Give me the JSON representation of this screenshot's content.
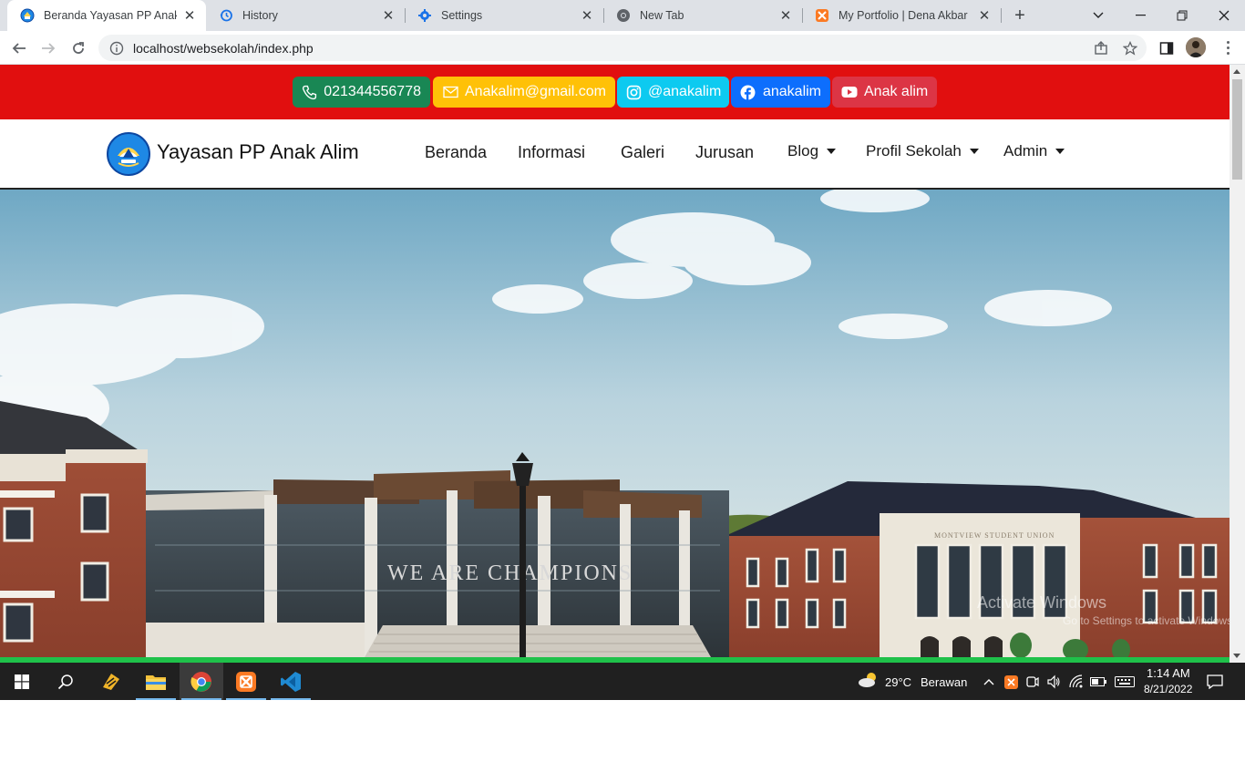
{
  "browser": {
    "tabs": [
      {
        "title": "Beranda Yayasan PP Anak Alim",
        "icon": "school-favicon-icon",
        "active": true
      },
      {
        "title": "History",
        "icon": "history-icon",
        "active": false
      },
      {
        "title": "Settings",
        "icon": "settings-gear-icon",
        "active": false
      },
      {
        "title": "New Tab",
        "icon": "chrome-icon",
        "active": false
      },
      {
        "title": "My Portfolio | Dena Akbar Kh",
        "icon": "xampp-icon",
        "active": false
      }
    ],
    "url": "localhost/websekolah/index.php"
  },
  "topbar": {
    "phone": "021344556778",
    "email": "Anakalim@gmail.com",
    "instagram": "@anakalim",
    "facebook": "anakalim",
    "youtube": "Anak alim",
    "colors": {
      "bar": "#e10f0f",
      "phone": "#198754",
      "email": "#ffc107",
      "instagram": "#0dcaf0",
      "facebook": "#0d6efd",
      "youtube": "#dc3545"
    }
  },
  "navbar": {
    "brand": "Yayasan PP Anak Alim",
    "links": [
      "Beranda",
      "Informasi",
      "Galeri",
      "Jurusan",
      "Blog",
      "Profil Sekolah",
      "Admin"
    ]
  },
  "hero": {
    "signage_building": "WE ARE CHAMPIONS",
    "signage_union": "MONTVIEW STUDENT UNION"
  },
  "watermark": {
    "line1": "Activate Windows",
    "line2": "Go to Settings to activate Windows."
  },
  "taskbar": {
    "weather_temp": "29°C",
    "weather_text": "Berawan",
    "time": "1:14 AM",
    "date": "8/21/2022"
  }
}
